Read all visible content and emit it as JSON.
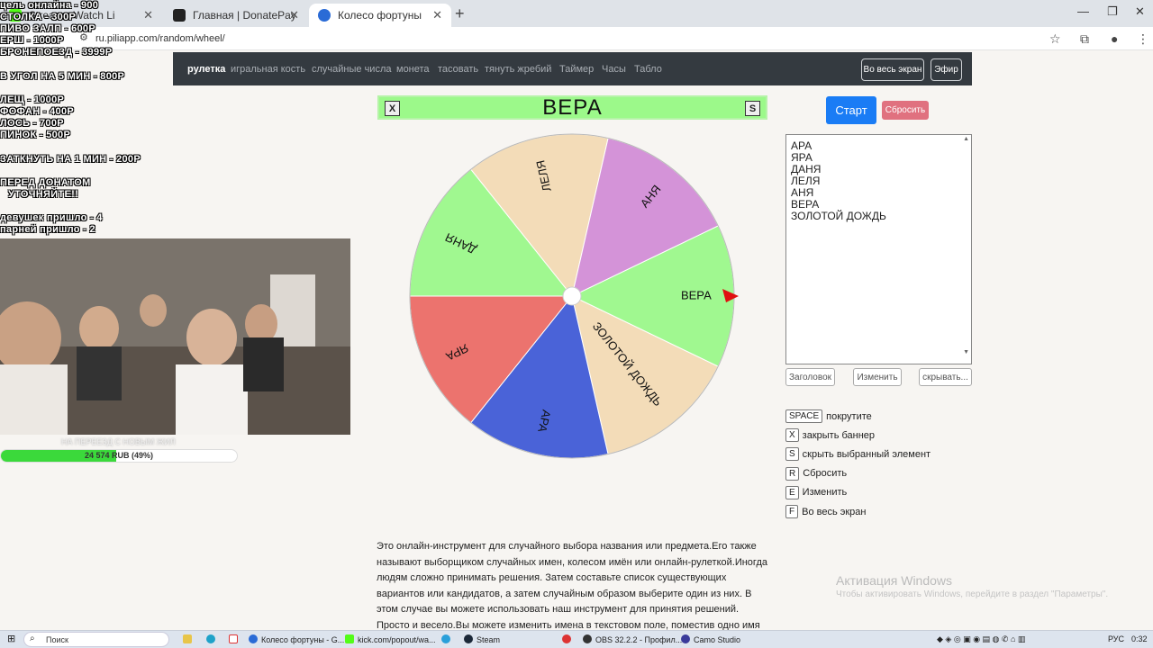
{
  "browser": {
    "tabs": [
      {
        "title": "Stream - Watch Li",
        "color": "#53fc18"
      },
      {
        "title": "Главная | DonatePay",
        "color": "#222222"
      },
      {
        "title": "Колесо фортуны",
        "color": "#2a6bd6"
      }
    ],
    "url": "ru.piliapp.com/random/wheel/"
  },
  "nav": {
    "links": [
      "рулетка",
      "игральная кость",
      "случайные числа",
      "монета",
      "тасовать",
      "тянуть жребий",
      "Таймер",
      "Часы",
      "Табло"
    ],
    "fullscreen_label": "Во весь экран",
    "live_label": "Эфир"
  },
  "banner": {
    "close_key": "X",
    "title": "ВЕРА",
    "hide_key": "S",
    "color": "#9cf98a"
  },
  "wheel": {
    "segments": [
      {
        "label": "ВЕРА",
        "color": "#a0f890"
      },
      {
        "label": "ЗОЛОТОЙ ДОЖДЬ",
        "color": "#f3dcb8"
      },
      {
        "label": "АРА",
        "color": "#4a63d8"
      },
      {
        "label": "ЯРА",
        "color": "#ec736e"
      },
      {
        "label": "ДАНЯ",
        "color": "#a0f890"
      },
      {
        "label": "ЛЕЛЯ",
        "color": "#f3dcb8"
      },
      {
        "label": "АНЯ",
        "color": "#d493d8"
      }
    ],
    "pointer_color": "#e01010"
  },
  "controls": {
    "start_label": "Старт",
    "reset_label": "Сбросить",
    "names": [
      "АРА",
      "ЯРА",
      "ДАНЯ",
      "ЛЕЛЯ",
      "АНЯ",
      "ВЕРА",
      "ЗОЛОТОЙ ДОЖДЬ"
    ],
    "title_btn": "Заголовок",
    "edit_btn": "Изменить",
    "hide_btn": "скрывать..."
  },
  "shortcuts": [
    {
      "key": "SPACE",
      "label": "покрутите"
    },
    {
      "key": "X",
      "label": "закрыть баннер"
    },
    {
      "key": "S",
      "label": "скрыть выбранный элемент"
    },
    {
      "key": "R",
      "label": "Сбросить"
    },
    {
      "key": "E",
      "label": "Изменить"
    },
    {
      "key": "F",
      "label": "Во весь экран"
    }
  ],
  "description": "Это онлайн-инструмент для случайного выбора названия или предмета.Его также называют выборщиком случайных имен, колесом имён или онлайн-рулеткой.Иногда людям сложно принимать решения. Затем составьте список существующих вариантов или кандидатов, а затем случайным образом выберите один из них. В этом случае вы можете использовать наш инструмент для принятия решений. Просто и весело.Вы можете изменить имена в текстовом поле, поместив одно имя в строку.Имена будут",
  "watermark": {
    "title": "Активация Windows",
    "subtitle": "Чтобы активировать Windows, перейдите в раздел \"Параметры\"."
  },
  "overlay": {
    "lines": [
      "цель онлайна - 900",
      "СТОЛКА - 300Р",
      "ПИВО ЗАЛП - 600Р",
      "ЕРШ - 1000Р",
      "БРОНЕПОЕЗД - 3999Р",
      "В УГОЛ НА 5 МИН - 800Р",
      "ЛЕЩ - 1000Р",
      "ФОФАН - 400Р",
      "ЛОСЬ - 700Р",
      "ПИНОК - 500Р",
      "ЗАТКНУТЬ НА 1 МИН - 200Р",
      "ПЕРЕД ДОНАТОМ",
      "УТОЧНЯЙТЕ!!",
      "девушек пришло - 4",
      "парней пришло - 2"
    ],
    "goal_label": "НА ПЕРЕЕЗД С НОВЫМ ЖИЛ",
    "goal_text": "24 574 RUB (49%)",
    "goal_progress": 0.49
  },
  "taskbar": {
    "search_placeholder": "Поиск",
    "items": [
      "Колесо фортуны - G...",
      "kick.com/popout/wa...",
      "Steam",
      "OBS 32.2.2 - Профил...",
      "Camo Studio"
    ],
    "lang": "РУС",
    "time": "0:32"
  }
}
